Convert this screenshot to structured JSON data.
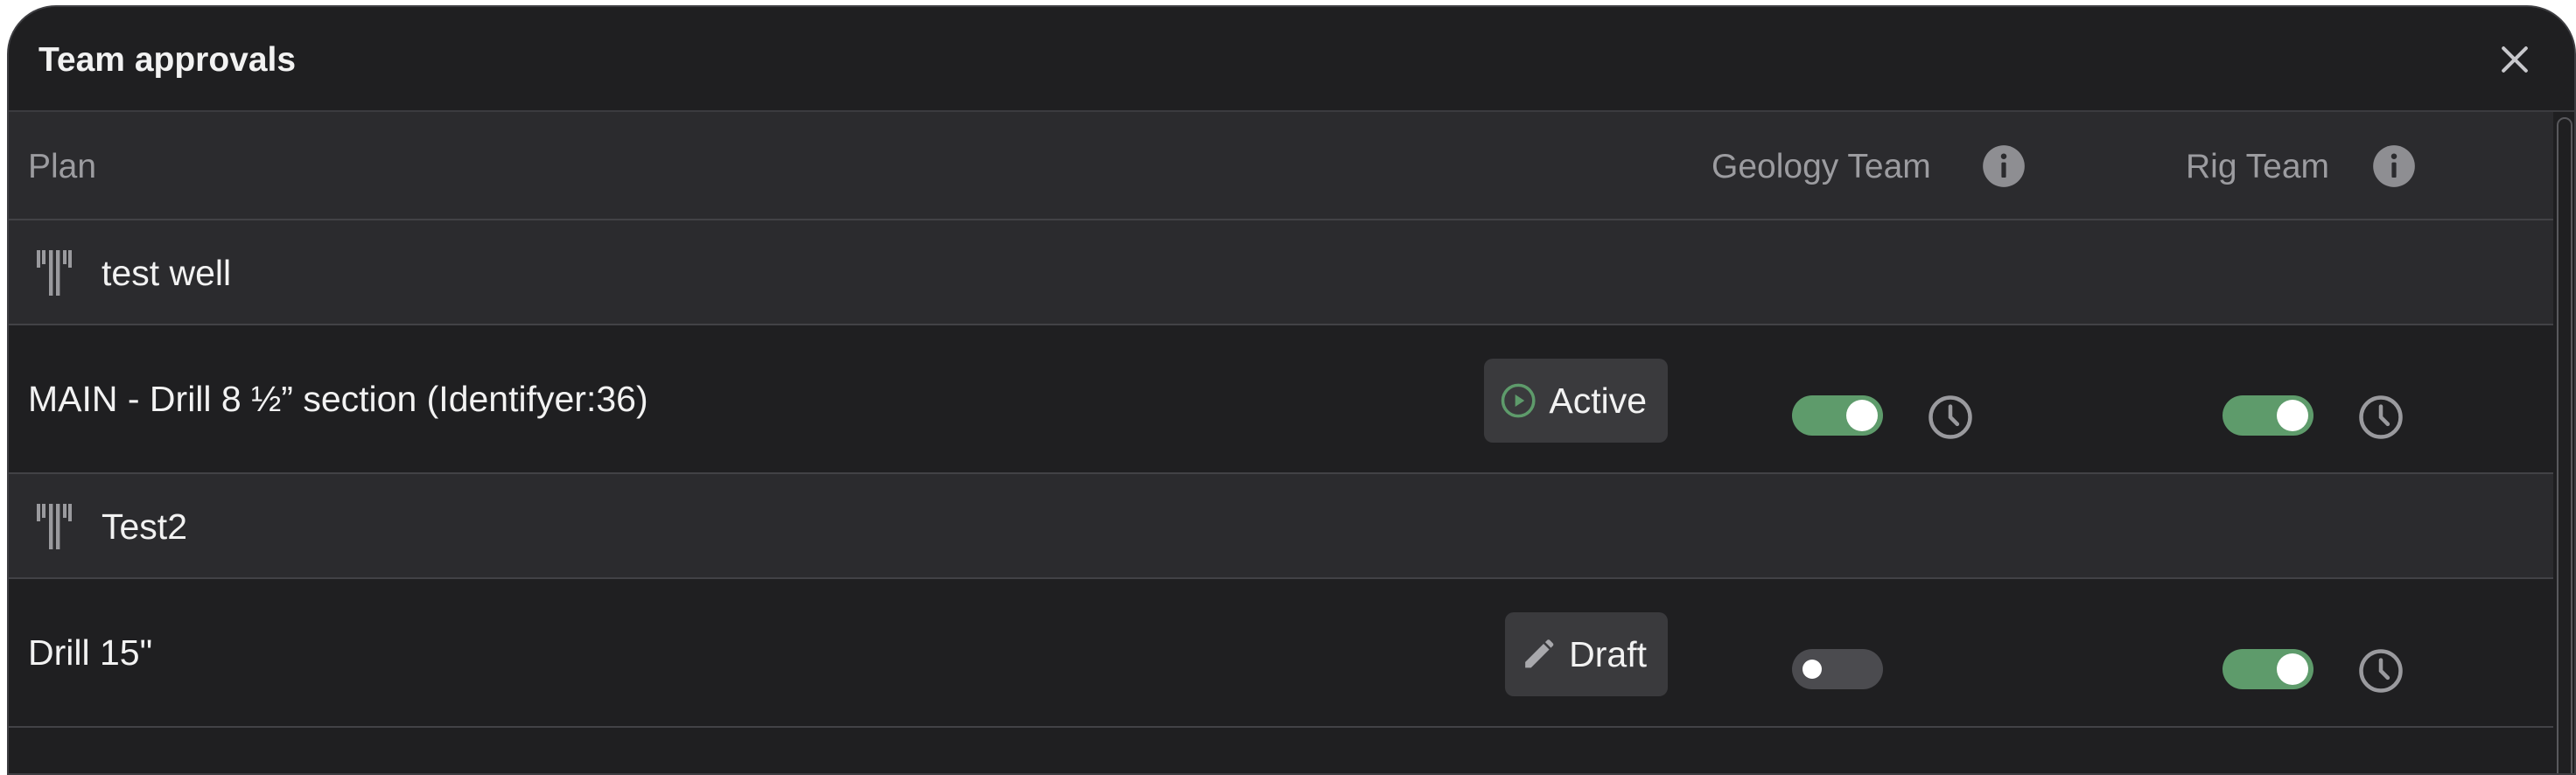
{
  "dialog": {
    "title": "Team approvals",
    "close_icon": "close-icon"
  },
  "table": {
    "columns": {
      "plan": "Plan",
      "geology": "Geology Team",
      "rig": "Rig Team"
    },
    "groups": [
      {
        "name": "test well",
        "icon": "well-icon",
        "plans": [
          {
            "name": "MAIN - Drill 8 ½” section (Identifyer:36)",
            "status": "Active",
            "status_icon": "play-circle-icon",
            "geology_approved": true,
            "geology_history": true,
            "rig_approved": true,
            "rig_history": true
          }
        ]
      },
      {
        "name": "Test2",
        "icon": "well-icon",
        "plans": [
          {
            "name": "Drill 15\"",
            "status": "Draft",
            "status_icon": "pencil-icon",
            "geology_approved": false,
            "geology_history": false,
            "rig_approved": true,
            "rig_history": true
          }
        ]
      }
    ]
  },
  "colors": {
    "background": "#1f1f21",
    "row_alt": "#2b2b2e",
    "toggle_on": "#5e9b6b",
    "toggle_off": "#4b4b4f",
    "chip": "#3a3a3d",
    "active_icon": "#5e9b6b"
  }
}
